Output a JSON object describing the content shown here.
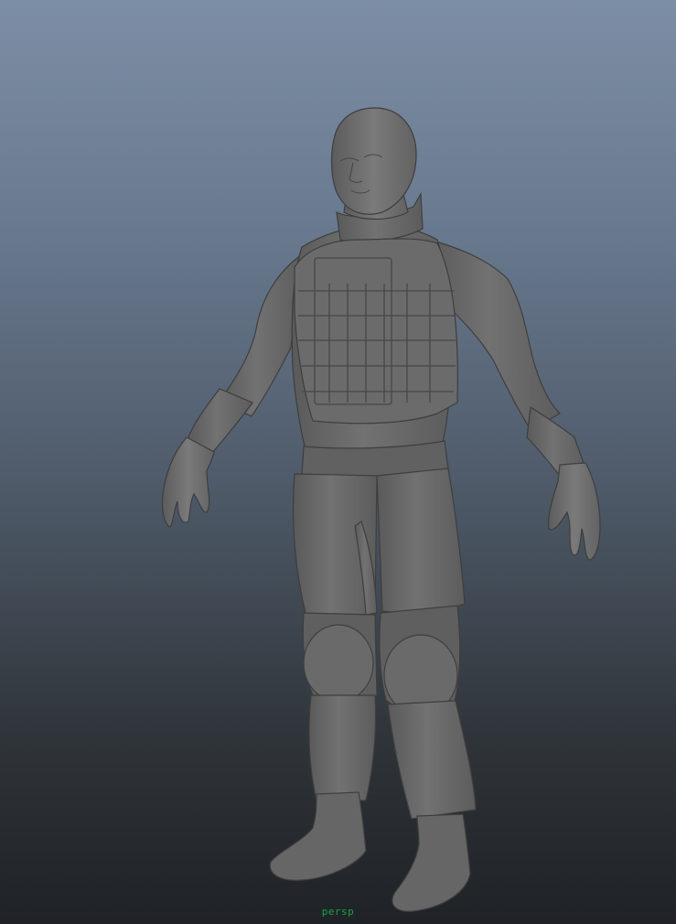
{
  "viewport": {
    "camera_label": "persp",
    "camera_label_color": "#1aa34a",
    "background_top": "#7c8ea5",
    "background_bottom": "#1f2226",
    "model_color": "#6a6a6a",
    "model_shadow": "#4a4a4a",
    "model_highlight": "#7f7f7f",
    "model_line": "#3e3e3e"
  }
}
